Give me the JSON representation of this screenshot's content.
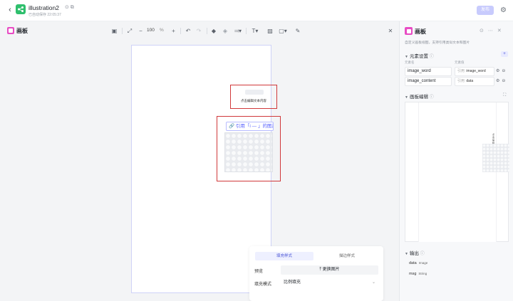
{
  "topbar": {
    "title": "illustration2",
    "title_icons": "⊙ ⧉",
    "saved_text": "已自动保存 22:05:37",
    "publish_label": "发布",
    "back_icon": "chevron-left-icon",
    "settings_icon": "gear-icon",
    "accent_color": "#2fbf6d"
  },
  "canvas": {
    "panel_title": "画板",
    "zoom_value": "100",
    "zoom_unit": "%",
    "text_element_label": "点击编辑文本内容",
    "image_reference": "🔗 引用「i — 」的图片",
    "fill_card": {
      "tab_active": "填充样式",
      "tab_other": "描边样式",
      "preview_label": "预览",
      "replace_label": "⤒  更换图片",
      "fill_mode_label": "填充模式",
      "fill_mode_value": "比例填充"
    }
  },
  "right_panel": {
    "title": "画板",
    "description": "自定义画板视图，支持引用类似文本和图片",
    "element_settings": {
      "title": "元素设置",
      "col_element": "元素名",
      "col_value": "元素值",
      "rows": [
        {
          "name": "image_word",
          "value_prefix": "引用",
          "value": "image_word"
        },
        {
          "name": "image_content",
          "value_prefix": "引用",
          "value": "data"
        }
      ]
    },
    "canvas_edit": {
      "title": "画板编辑"
    },
    "output": {
      "title": "输出",
      "items": [
        {
          "name": "data",
          "type": "Image"
        },
        {
          "name": "msg",
          "type": "String"
        }
      ]
    },
    "accent_color": "#e84cc4",
    "selection_color": "#d0383a"
  }
}
